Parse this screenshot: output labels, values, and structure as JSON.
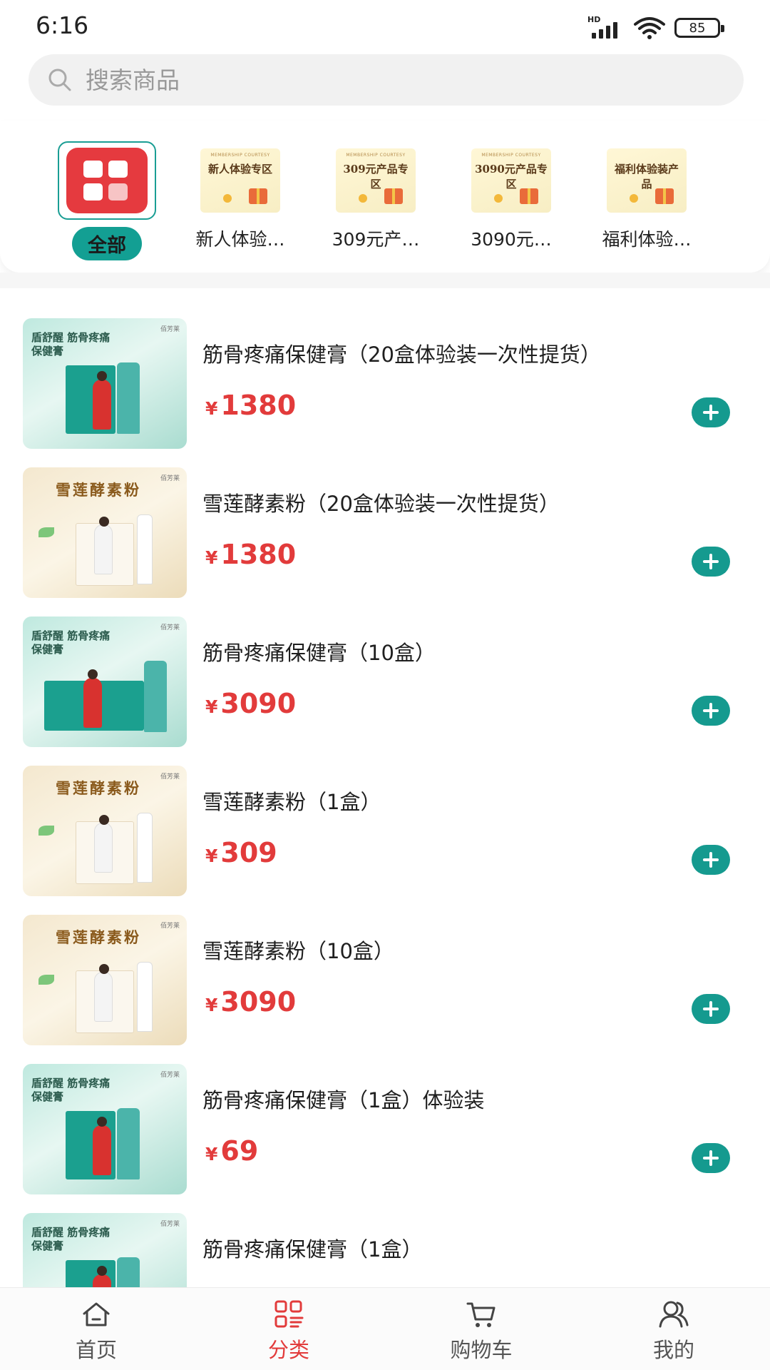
{
  "status_bar": {
    "time": "6:16",
    "network": "HD",
    "battery": "85"
  },
  "search": {
    "placeholder": "搜索商品"
  },
  "categories": [
    {
      "label": "全部",
      "active": true,
      "icon": "grid-icon"
    },
    {
      "label": "新人体验…",
      "thumb_small": "MEMBERSHIP COURTESY",
      "thumb_title": "新人体验专区"
    },
    {
      "label": "309元产…",
      "thumb_small": "MEMBERSHIP COURTESY",
      "thumb_title": "309元产品专区"
    },
    {
      "label": "3090元…",
      "thumb_small": "MEMBERSHIP COURTESY",
      "thumb_title": "3090元产品专区"
    },
    {
      "label": "福利体验…",
      "thumb_small": "",
      "thumb_title": "福利体验装产品"
    }
  ],
  "products": [
    {
      "name": "筋骨疼痛保健膏（20盒体验装一次性提货）",
      "currency": "¥",
      "price": "1380",
      "image_title": "盾舒醒 筋骨疼痛保健膏",
      "image_brand": "佰芳莱"
    },
    {
      "name": "雪莲酵素粉（20盒体验装一次性提货）",
      "currency": "¥",
      "price": "1380",
      "image_title": "雪莲酵素粉",
      "image_brand": "佰芳莱"
    },
    {
      "name": "筋骨疼痛保健膏（10盒）",
      "currency": "¥",
      "price": "3090",
      "image_title": "盾舒醒 筋骨疼痛保健膏",
      "image_brand": "佰芳莱"
    },
    {
      "name": "雪莲酵素粉（1盒）",
      "currency": "¥",
      "price": "309",
      "image_title": "雪莲酵素粉",
      "image_brand": "佰芳莱"
    },
    {
      "name": "雪莲酵素粉（10盒）",
      "currency": "¥",
      "price": "3090",
      "image_title": "雪莲酵素粉",
      "image_brand": "佰芳莱"
    },
    {
      "name": "筋骨疼痛保健膏（1盒）体验装",
      "currency": "¥",
      "price": "69",
      "image_title": "盾舒醒 筋骨疼痛保健膏",
      "image_brand": "佰芳莱"
    },
    {
      "name": "筋骨疼痛保健膏（1盒）",
      "currency": "¥",
      "price": "",
      "image_title": "盾舒醒 筋骨疼痛保健膏",
      "image_brand": "佰芳莱"
    }
  ],
  "nav": [
    {
      "label": "首页",
      "icon": "home-icon"
    },
    {
      "label": "分类",
      "icon": "category-icon",
      "active": true
    },
    {
      "label": "购物车",
      "icon": "cart-icon"
    },
    {
      "label": "我的",
      "icon": "user-icon"
    }
  ],
  "colors": {
    "accent": "#159a8f",
    "price": "#e23b3b",
    "all_icon": "#e53a3f",
    "active_nav": "#e23b3b"
  }
}
